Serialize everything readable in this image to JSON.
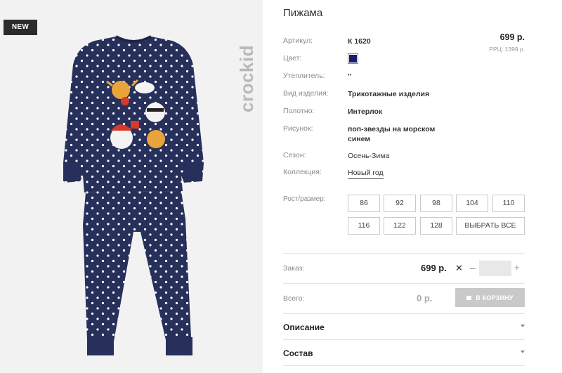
{
  "photo": {
    "badge": "NEW",
    "brand": "crockid",
    "colors": {
      "fabric": "#27305a",
      "dots": "#ffffff",
      "background": "#f2f2f2"
    }
  },
  "product": {
    "title": "Пижама",
    "price": "699 р.",
    "rrp": "РРЦ: 1399 р.",
    "specs": [
      {
        "label": "Артикул:",
        "value": "К 1620"
      },
      {
        "label": "Цвет:",
        "value": ""
      },
      {
        "label": "Утеплитель:",
        "value": "\""
      },
      {
        "label": "Вид изделия:",
        "value": "Трикотажные изделия"
      },
      {
        "label": "Полотно:",
        "value": "Интерлок"
      },
      {
        "label": "Рисунок:",
        "value": "поп-звезды на морском синем"
      },
      {
        "label": "Сезон:",
        "value": "Осень-Зима"
      },
      {
        "label": "Коллекция:",
        "value": "Новый год"
      }
    ],
    "color_swatch": "#1c1a6b"
  },
  "sizes": {
    "label": "Рост/размер:",
    "options": [
      "86",
      "92",
      "98",
      "104",
      "110",
      "116",
      "122",
      "128"
    ],
    "select_all": "ВЫБРАТЬ ВСЕ"
  },
  "order": {
    "label": "Заказ:",
    "price": "699 р.",
    "times": "✕",
    "minus": "–",
    "plus": "+",
    "qty_value": ""
  },
  "total": {
    "label": "Всего:",
    "value": "0 р.",
    "cart_button": "В КОРЗИНУ"
  },
  "accordion": [
    "Описание",
    "Состав"
  ]
}
